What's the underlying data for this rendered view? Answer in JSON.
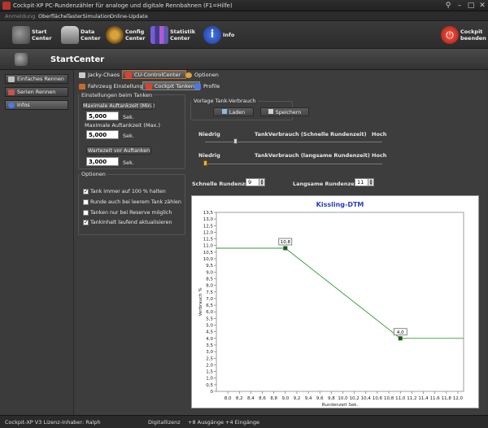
{
  "window": {
    "title": "Cockpit-XP PC-Rundenzähler für analoge und digitale Rennbahnen (F1=Hilfe)"
  },
  "menu": [
    "Anmeldung",
    "Oberfläche",
    "TasterSimulation",
    "Online-Update"
  ],
  "toolbar": {
    "start": "Start\nCenter",
    "data": "Data\nCenter",
    "config": "Config\nCenter",
    "statistik": "Statistik\nCenter",
    "info": "Info",
    "quit": "Cockpit\nbeenden"
  },
  "header": {
    "title": "StartCenter"
  },
  "nav": [
    "Einfaches Rennen",
    "Serien Rennen",
    "Infos"
  ],
  "tabs_top": [
    "Jacky-Chaos",
    "CU-ControlCenter",
    "Optionen"
  ],
  "tabs_sub": [
    "Fahrzeug Einstellungen",
    "Cockpit Tanken",
    "Profile"
  ],
  "tanken": {
    "group_title": "Einstellungen beim Tanken",
    "min_label": "Maximale Auftankzeit (Min.)",
    "min_value": "5,000",
    "max_label": "Maximale Auftankzeit (Max.)",
    "max_value": "5,000",
    "wait_label": "Wartezeit vor Auftanken",
    "wait_value": "3,000",
    "unit": "Sek."
  },
  "optionen": {
    "title": "Optionen",
    "items": [
      {
        "label": "Tank immer auf 100 % halten",
        "checked": true
      },
      {
        "label": "Runde auch bei leerem Tank zählen",
        "checked": false
      },
      {
        "label": "Tanken nur bei Reserve möglich",
        "checked": false
      },
      {
        "label": "TankInhalt laufend aktualisieren",
        "checked": true
      }
    ]
  },
  "vorlage": {
    "title": "Vorlage Tank-Verbrauch",
    "load": "Laden",
    "save": "Speichern"
  },
  "slider_fast": {
    "low": "Niedrig",
    "label": "TankVerbrauch (Schnelle Rundenzeit)",
    "high": "Hoch",
    "level": 0.17
  },
  "slider_slow": {
    "low": "Niedrig",
    "label": "TankVerbrauch (langsame Rundenzeit)",
    "high": "Hoch",
    "level": 0.0
  },
  "rundenzeit": {
    "fast_label": "Schnelle Rundenzeit",
    "fast_value": "9",
    "slow_label": "Langsame Rundenzeit",
    "slow_value": "11"
  },
  "chart_data": {
    "type": "line",
    "title": "Kissling-DTM",
    "xlabel": "Rundenzeit Sek.",
    "ylabel": "Verbrauch %",
    "xlim": [
      7.8,
      12.1
    ],
    "ylim": [
      0,
      13.5
    ],
    "xticks": [
      "8,0",
      "8,2",
      "8,4",
      "8,6",
      "8,8",
      "9,0",
      "9,2",
      "9,4",
      "9,6",
      "9,8",
      "10,0",
      "10,2",
      "10,4",
      "10,6",
      "10,8",
      "11,0",
      "11,2",
      "11,4",
      "11,6",
      "11,8",
      "12,0"
    ],
    "yticks": [
      "0",
      "0,5",
      "1,0",
      "1,5",
      "2,0",
      "2,5",
      "3,0",
      "3,5",
      "4,0",
      "4,5",
      "5,0",
      "5,5",
      "6,0",
      "6,5",
      "7,0",
      "7,5",
      "8,0",
      "8,5",
      "9,0",
      "9,5",
      "10,0",
      "10,5",
      "11,0",
      "11,5",
      "12,0",
      "12,5",
      "13,0",
      "13,5"
    ],
    "series": [
      {
        "x": [
          7.8,
          9.0,
          11.0,
          12.1
        ],
        "y": [
          10.8,
          10.8,
          4.0,
          4.0
        ],
        "color": "#2e9a2e"
      }
    ],
    "markers": [
      {
        "x": 9.0,
        "y": 10.8,
        "label": "10,8"
      },
      {
        "x": 11.0,
        "y": 4.0,
        "label": "4,0"
      }
    ],
    "title_color": "#2b3dbf"
  },
  "status": {
    "license": "Cockpit-XP V3 Lizenz-Inhaber: Ralph",
    "mode": "Digitallizenz",
    "io": "+8 Ausgänge +4 Eingänge"
  }
}
